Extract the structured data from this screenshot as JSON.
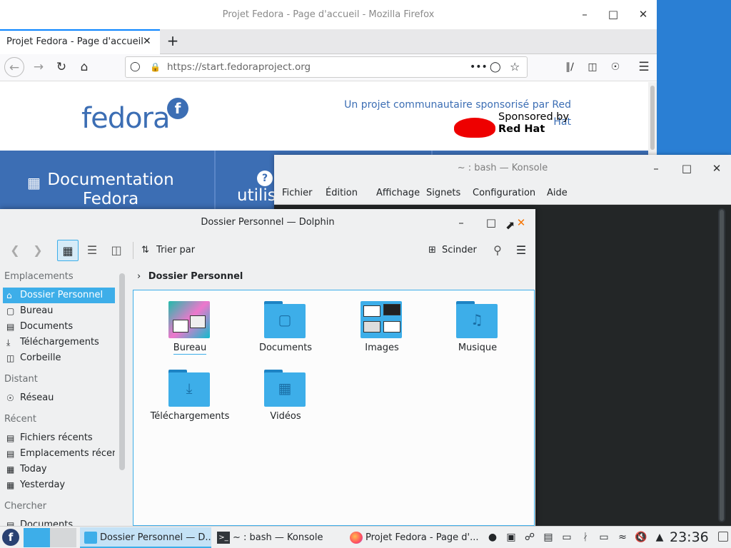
{
  "firefox": {
    "window_title": "Projet Fedora - Page d'accueil - Mozilla Firefox",
    "tab_label": "Projet Fedora - Page d'accueil",
    "url": "https://start.fedoraproject.org",
    "page": {
      "logo_text": "fedora",
      "sponsor_line": "Un projet communautaire sponsorisé par Red Hat",
      "sponsor_brand_1": "Sponsored by",
      "sponsor_brand_2": "Red Hat",
      "band_doc": "Documentation Fedora",
      "band_users": "utilis"
    }
  },
  "konsole": {
    "window_title": "~ : bash — Konsole",
    "menu": [
      "Fichier",
      "Édition",
      "Affichage",
      "Signets",
      "Configuration",
      "Aide"
    ]
  },
  "dolphin": {
    "window_title": "Dossier Personnel — Dolphin",
    "toolbar": {
      "sort_label": "Trier par",
      "split_label": "Scinder"
    },
    "breadcrumb": "Dossier Personnel",
    "sidebar": {
      "places_heading": "Emplacements",
      "places": [
        "Dossier Personnel",
        "Bureau",
        "Documents",
        "Téléchargements",
        "Corbeille"
      ],
      "remote_heading": "Distant",
      "remote": [
        "Réseau"
      ],
      "recent_heading": "Récent",
      "recent": [
        "Fichiers récents",
        "Emplacements récents",
        "Today",
        "Yesterday"
      ],
      "search_heading": "Chercher",
      "search": [
        "Documents"
      ]
    },
    "items": [
      {
        "label": "Bureau",
        "icon": "desktop-thumbnail"
      },
      {
        "label": "Documents",
        "icon": "document-icon"
      },
      {
        "label": "Images",
        "icon": "images-thumbnail"
      },
      {
        "label": "Musique",
        "icon": "music-note-icon"
      },
      {
        "label": "Téléchargements",
        "icon": "download-icon"
      },
      {
        "label": "Vidéos",
        "icon": "film-icon"
      }
    ]
  },
  "taskbar": {
    "tasks": [
      "Dossier Personnel — D...",
      "~ : bash — Konsole",
      "Projet Fedora - Page d'..."
    ],
    "clock": "23:36"
  },
  "colors": {
    "accent": "#3daee9",
    "fedora_blue": "#3c6eb4",
    "terminal_bg": "#232627"
  }
}
